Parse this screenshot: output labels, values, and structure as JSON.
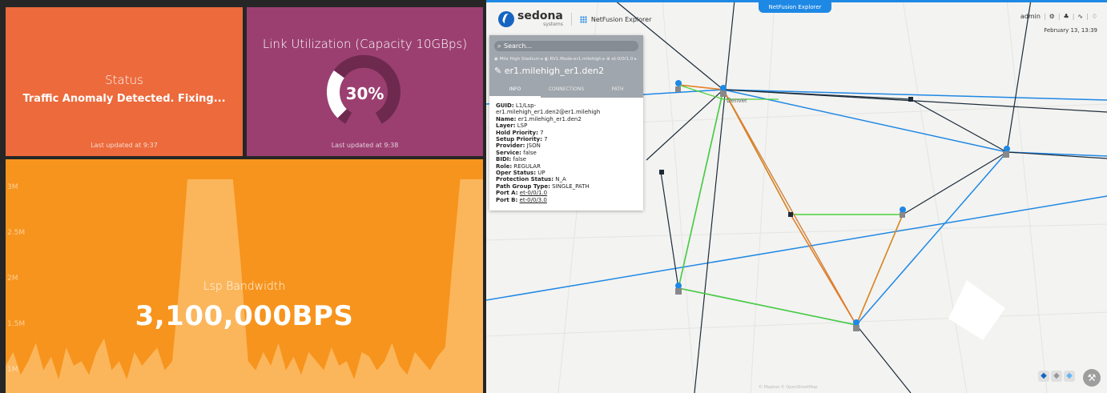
{
  "status_tile": {
    "title": "Status",
    "message": "Traffic Anomaly Detected. Fixing...",
    "updated": "Last updated at 9:37",
    "color": "#ec6a3c"
  },
  "link_tile": {
    "title": "Link Utilization (Capacity 10GBps)",
    "value_label": "30%",
    "value": 0.3,
    "updated": "Last updated at 9:38",
    "color": "#9b3f71"
  },
  "bandwidth_tile": {
    "title": "Lsp Bandwidth",
    "value_label": "3,100,000BPS",
    "color": "#f7941d"
  },
  "chart_data": {
    "type": "area",
    "title": "",
    "xlabel": "",
    "ylabel": "",
    "yticks": [
      "3M",
      "2.5M",
      "2M",
      "1.5M",
      "1M"
    ],
    "ylim": [
      0.75,
      3.25
    ],
    "values": [
      1.05,
      1.2,
      0.95,
      1.1,
      1.3,
      1.0,
      1.15,
      0.9,
      1.25,
      1.05,
      1.1,
      0.95,
      1.2,
      1.35,
      1.0,
      1.1,
      0.9,
      1.2,
      1.05,
      1.15,
      1.25,
      1.0,
      1.1,
      2.0,
      3.1,
      3.1,
      3.1,
      3.1,
      3.1,
      3.1,
      3.1,
      2.2,
      1.1,
      1.0,
      1.2,
      1.05,
      1.3,
      1.0,
      1.15,
      0.95,
      1.2,
      1.1,
      1.0,
      1.25,
      1.05,
      1.1,
      0.9,
      1.2,
      1.15,
      1.0,
      1.1,
      1.3,
      1.05,
      0.95,
      1.2,
      1.1,
      1.0,
      1.15,
      1.25,
      2.2,
      3.1,
      3.1,
      3.1,
      3.1
    ],
    "grid": false
  },
  "map_app": {
    "tab_label": "NetFusion Explorer",
    "logo": "sedona",
    "logo_sub": "systems",
    "app_name": "NetFusion Explorer",
    "user": "admin",
    "date": "February 13, 13:39",
    "node_label": "Denver",
    "attribution": "© Mapbox © OpenStreetMap"
  },
  "panel": {
    "search_placeholder": "Search...",
    "breadcrumb": "◉ Mile High Stadium ▸ ◐ RV1.Mode-er1.milehigh ▸ ⊕ et-0/0/1.0 ▸",
    "entity": "er1.milehigh_er1.den2",
    "tabs": [
      "INFO",
      "CONNECTIONS",
      "PATH"
    ],
    "props": [
      {
        "k": "GUID:",
        "v": "L1/Lsp-er1.milehigh_er1.den2@er1.milehigh"
      },
      {
        "k": "Name:",
        "v": "er1.milehigh_er1.den2"
      },
      {
        "k": "Layer:",
        "v": "LSP"
      },
      {
        "k": "Hold Priority:",
        "v": "7"
      },
      {
        "k": "Setup Priority:",
        "v": "7"
      },
      {
        "k": "Provider:",
        "v": "JSON"
      },
      {
        "k": "Service:",
        "v": "false"
      },
      {
        "k": "BIDI:",
        "v": "false"
      },
      {
        "k": "Role:",
        "v": "REGULAR"
      },
      {
        "k": "Oper Status:",
        "v": "UP"
      },
      {
        "k": "Protection Status:",
        "v": "N_A"
      },
      {
        "k": "Path Group Type:",
        "v": "SINGLE_PATH"
      },
      {
        "k": "Port A:",
        "v": "et-0/0/1.0",
        "link": true
      },
      {
        "k": "Port B:",
        "v": "et-0/0/3.0",
        "link": true
      }
    ]
  },
  "icons": {
    "settings": "gear-icon",
    "extensions": "puzzle-icon",
    "activity": "pulse-icon",
    "notifications": "bell-icon",
    "tools": "wrench-icon",
    "layers": "layers-icon"
  }
}
